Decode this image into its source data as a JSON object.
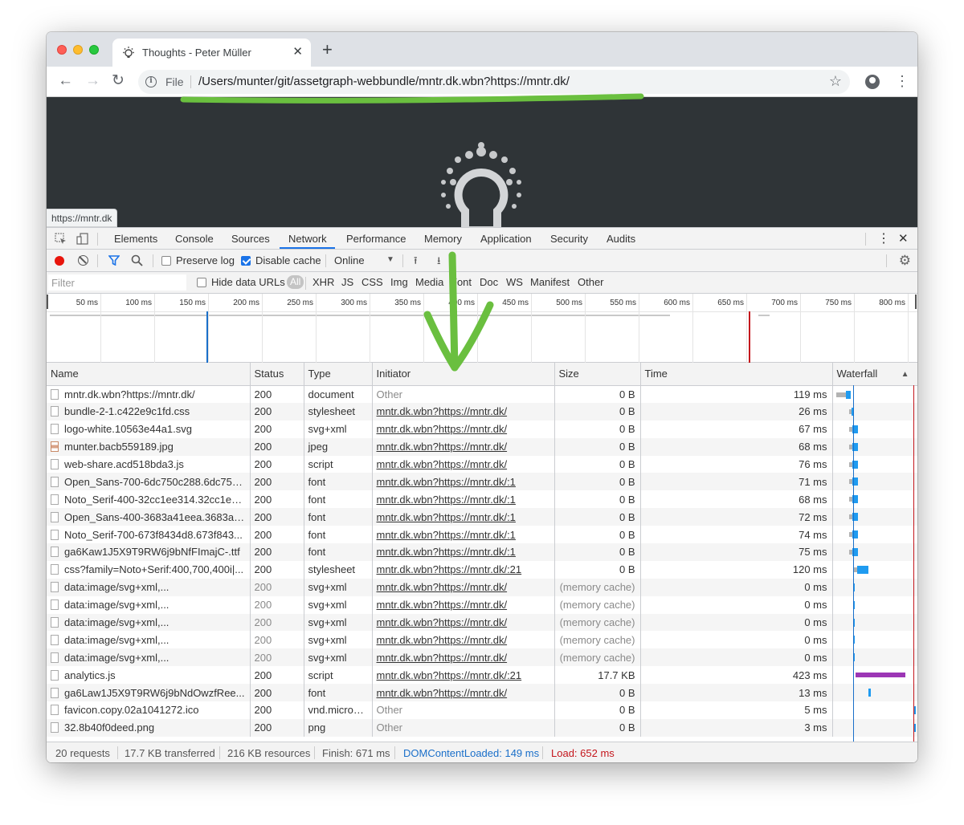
{
  "browser": {
    "tab_title": "Thoughts - Peter Müller",
    "tab_close": "✕",
    "new_tab": "+",
    "scheme_label": "File",
    "url": "/Users/munter/git/assetgraph-webbundle/mntr.dk.wbn?https://mntr.dk/",
    "status_tooltip": "https://mntr.dk"
  },
  "devtools": {
    "tabs": [
      "Elements",
      "Console",
      "Sources",
      "Network",
      "Performance",
      "Memory",
      "Application",
      "Security",
      "Audits"
    ],
    "active_tab": "Network",
    "toolbar": {
      "preserve_log": "Preserve log",
      "preserve_log_checked": false,
      "disable_cache": "Disable cache",
      "disable_cache_checked": true,
      "throttling": "Online"
    },
    "filter": {
      "placeholder": "Filter",
      "hide_data_urls": "Hide data URLs",
      "types": [
        "All",
        "XHR",
        "JS",
        "CSS",
        "Img",
        "Media",
        "Font",
        "Doc",
        "WS",
        "Manifest",
        "Other"
      ]
    },
    "overview_ticks": [
      "50 ms",
      "100 ms",
      "150 ms",
      "200 ms",
      "250 ms",
      "300 ms",
      "350 ms",
      "400 ms",
      "450 ms",
      "500 ms",
      "550 ms",
      "600 ms",
      "650 ms",
      "700 ms",
      "750 ms",
      "800 ms"
    ],
    "columns": [
      "Name",
      "Status",
      "Type",
      "Initiator",
      "Size",
      "Time",
      "Waterfall"
    ],
    "requests": [
      {
        "name": "mntr.dk.wbn?https://mntr.dk/",
        "status": "200",
        "type": "document",
        "initiator": "Other",
        "initiator_link": false,
        "size": "0 B",
        "time": "119 ms",
        "icon": "doc"
      },
      {
        "name": "bundle-2-1.c422e9c1fd.css",
        "status": "200",
        "type": "stylesheet",
        "initiator": "mntr.dk.wbn?https://mntr.dk/",
        "initiator_link": true,
        "size": "0 B",
        "time": "26 ms",
        "icon": "doc"
      },
      {
        "name": "logo-white.10563e44a1.svg",
        "status": "200",
        "type": "svg+xml",
        "initiator": "mntr.dk.wbn?https://mntr.dk/",
        "initiator_link": true,
        "size": "0 B",
        "time": "67 ms",
        "icon": "doc"
      },
      {
        "name": "munter.bacb559189.jpg",
        "status": "200",
        "type": "jpeg",
        "initiator": "mntr.dk.wbn?https://mntr.dk/",
        "initiator_link": true,
        "size": "0 B",
        "time": "68 ms",
        "icon": "img"
      },
      {
        "name": "web-share.acd518bda3.js",
        "status": "200",
        "type": "script",
        "initiator": "mntr.dk.wbn?https://mntr.dk/",
        "initiator_link": true,
        "size": "0 B",
        "time": "76 ms",
        "icon": "doc"
      },
      {
        "name": "Open_Sans-700-6dc750c288.6dc750...",
        "status": "200",
        "type": "font",
        "initiator": "mntr.dk.wbn?https://mntr.dk/:1",
        "initiator_link": true,
        "size": "0 B",
        "time": "71 ms",
        "icon": "doc"
      },
      {
        "name": "Noto_Serif-400-32cc1ee314.32cc1ee...",
        "status": "200",
        "type": "font",
        "initiator": "mntr.dk.wbn?https://mntr.dk/:1",
        "initiator_link": true,
        "size": "0 B",
        "time": "68 ms",
        "icon": "doc"
      },
      {
        "name": "Open_Sans-400-3683a41eea.3683a4...",
        "status": "200",
        "type": "font",
        "initiator": "mntr.dk.wbn?https://mntr.dk/:1",
        "initiator_link": true,
        "size": "0 B",
        "time": "72 ms",
        "icon": "doc"
      },
      {
        "name": "Noto_Serif-700-673f8434d8.673f843...",
        "status": "200",
        "type": "font",
        "initiator": "mntr.dk.wbn?https://mntr.dk/:1",
        "initiator_link": true,
        "size": "0 B",
        "time": "74 ms",
        "icon": "doc"
      },
      {
        "name": "ga6Kaw1J5X9T9RW6j9bNfFImajC-.ttf",
        "status": "200",
        "type": "font",
        "initiator": "mntr.dk.wbn?https://mntr.dk/:1",
        "initiator_link": true,
        "size": "0 B",
        "time": "75 ms",
        "icon": "doc"
      },
      {
        "name": "css?family=Noto+Serif:400,700,400i|...",
        "status": "200",
        "type": "stylesheet",
        "initiator": "mntr.dk.wbn?https://mntr.dk/:21",
        "initiator_link": true,
        "size": "0 B",
        "time": "120 ms",
        "icon": "doc"
      },
      {
        "name": "data:image/svg+xml,...",
        "status": "200",
        "type": "svg+xml",
        "initiator": "mntr.dk.wbn?https://mntr.dk/",
        "initiator_link": true,
        "size": "(memory cache)",
        "time": "0 ms",
        "icon": "doc"
      },
      {
        "name": "data:image/svg+xml,...",
        "status": "200",
        "type": "svg+xml",
        "initiator": "mntr.dk.wbn?https://mntr.dk/",
        "initiator_link": true,
        "size": "(memory cache)",
        "time": "0 ms",
        "icon": "doc"
      },
      {
        "name": "data:image/svg+xml,...",
        "status": "200",
        "type": "svg+xml",
        "initiator": "mntr.dk.wbn?https://mntr.dk/",
        "initiator_link": true,
        "size": "(memory cache)",
        "time": "0 ms",
        "icon": "doc"
      },
      {
        "name": "data:image/svg+xml,...",
        "status": "200",
        "type": "svg+xml",
        "initiator": "mntr.dk.wbn?https://mntr.dk/",
        "initiator_link": true,
        "size": "(memory cache)",
        "time": "0 ms",
        "icon": "doc"
      },
      {
        "name": "data:image/svg+xml,...",
        "status": "200",
        "type": "svg+xml",
        "initiator": "mntr.dk.wbn?https://mntr.dk/",
        "initiator_link": true,
        "size": "(memory cache)",
        "time": "0 ms",
        "icon": "doc"
      },
      {
        "name": "analytics.js",
        "status": "200",
        "type": "script",
        "initiator": "mntr.dk.wbn?https://mntr.dk/:21",
        "initiator_link": true,
        "size": "17.7 KB",
        "time": "423 ms",
        "icon": "doc"
      },
      {
        "name": "ga6Law1J5X9T9RW6j9bNdOwzfRee...",
        "status": "200",
        "type": "font",
        "initiator": "mntr.dk.wbn?https://mntr.dk/",
        "initiator_link": true,
        "size": "0 B",
        "time": "13 ms",
        "icon": "doc"
      },
      {
        "name": "favicon.copy.02a1041272.ico",
        "status": "200",
        "type": "vnd.micros...",
        "initiator": "Other",
        "initiator_link": false,
        "size": "0 B",
        "time": "5 ms",
        "icon": "doc"
      },
      {
        "name": "32.8b40f0deed.png",
        "status": "200",
        "type": "png",
        "initiator": "Other",
        "initiator_link": false,
        "size": "0 B",
        "time": "3 ms",
        "icon": "doc"
      }
    ],
    "summary": {
      "requests": "20 requests",
      "transferred": "17.7 KB transferred",
      "resources": "216 KB resources",
      "finish": "Finish: 671 ms",
      "dom_content_loaded": "DOMContentLoaded: 149 ms",
      "load": "Load: 652 ms"
    }
  },
  "colors": {
    "accent_blue": "#1a73e8",
    "dcl_blue": "#1a6fc9",
    "load_red": "#c4161c",
    "annotation_green": "#6abf3f",
    "analytics_purple": "#9c36b5"
  }
}
